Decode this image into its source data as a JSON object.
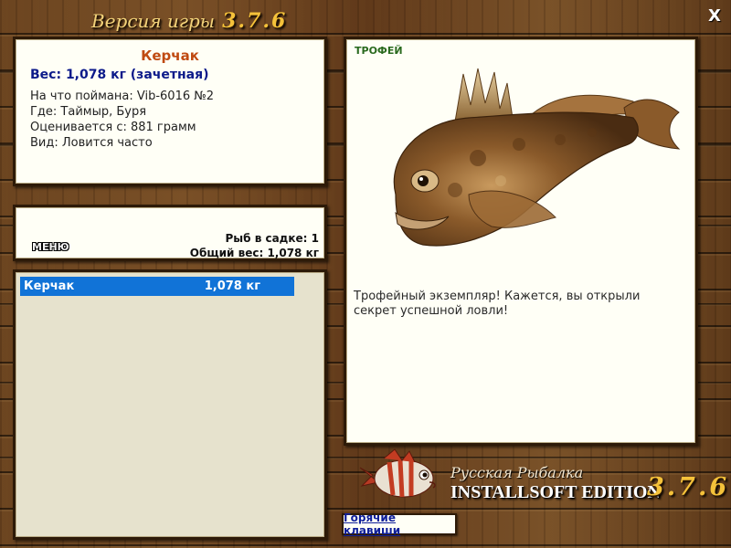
{
  "window": {
    "title": "Версия игры",
    "version": "3.7.6",
    "close_label": "X"
  },
  "fish_info": {
    "name": "Керчак",
    "weight": "Вес: 1,078 кг (зачетная)",
    "caught_with": "На что поймана: Vib-6016 №2",
    "location": "Где: Таймыр, Буря",
    "evaluated_from": "Оценивается с: 881 грамм",
    "frequency": "Вид: Ловится часто"
  },
  "keepnet": {
    "fish_count": "Рыб в садке: 1",
    "total_weight": "Общий вес: 1,078 кг",
    "menu_label": "МЕНЮ"
  },
  "catch_list": {
    "items": [
      {
        "name": "Керчак",
        "weight": "1,078 кг"
      }
    ]
  },
  "trophy": {
    "label": "ТРОФЕЙ",
    "description": "Трофейный экземпляр! Кажется, вы открыли секрет успешной ловли!"
  },
  "branding": {
    "title": "Русская Рыбалка",
    "edition": "INSTALLSOFT EDITION",
    "version": "3.7.6"
  },
  "footer": {
    "hotkeys_label": "Горячие клавиши"
  },
  "colors": {
    "wood": "#6b4420",
    "panel_bg": "#fffff6",
    "list_bg": "#e6e2cd",
    "selection": "#1173d7",
    "fish_name": "#c04a12",
    "weight_text": "#0c1a8a",
    "trophy_green": "#2a6a1e",
    "title_gold": "#f5c23a"
  }
}
